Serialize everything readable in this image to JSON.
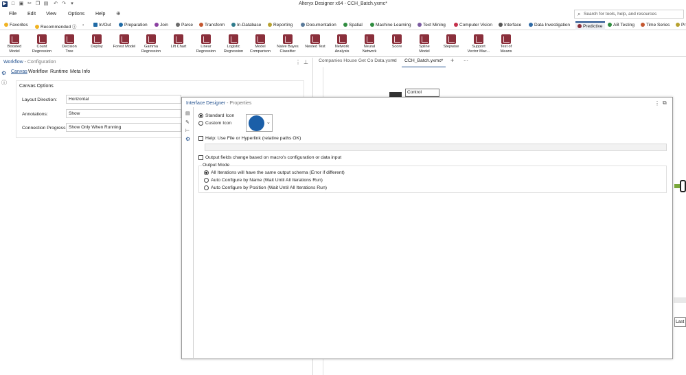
{
  "window": {
    "title": "Alteryx Designer x64 - CCH_Batch.yxmc*"
  },
  "menu": [
    "File",
    "Edit",
    "View",
    "Options",
    "Help"
  ],
  "search": {
    "placeholder": "Search for tools, help, and resources"
  },
  "categories": [
    {
      "label": "Favorites",
      "color": "#444444"
    },
    {
      "label": "Recommended",
      "color": "#444444"
    },
    {
      "label": "In/Out",
      "color": "#1f6aa5"
    },
    {
      "label": "Preparation",
      "color": "#1f6aa5"
    },
    {
      "label": "Join",
      "color": "#8a3fa0"
    },
    {
      "label": "Parse",
      "color": "#6a6a6a"
    },
    {
      "label": "Transform",
      "color": "#c4572f"
    },
    {
      "label": "In-Database",
      "color": "#2f7b8c"
    },
    {
      "label": "Reporting",
      "color": "#b7a12f"
    },
    {
      "label": "Documentation",
      "color": "#5a7a9a"
    },
    {
      "label": "Spatial",
      "color": "#2f8c3f"
    },
    {
      "label": "Machine Learning",
      "color": "#2f8c3f"
    },
    {
      "label": "Text Mining",
      "color": "#7a5aa0"
    },
    {
      "label": "Computer Vision",
      "color": "#c42f4a"
    },
    {
      "label": "Interface",
      "color": "#555555"
    },
    {
      "label": "Data Investigation",
      "color": "#2f6aa5"
    },
    {
      "label": "Predictive",
      "color": "#8a2f3b"
    },
    {
      "label": "AB Testing",
      "color": "#2f8c3f"
    },
    {
      "label": "Time Series",
      "color": "#c4572f"
    },
    {
      "label": "Pr",
      "color": "#b7a12f"
    }
  ],
  "tools": [
    {
      "l1": "Boosted",
      "l2": "Model"
    },
    {
      "l1": "Count",
      "l2": "Regression"
    },
    {
      "l1": "Decision",
      "l2": "Tree"
    },
    {
      "l1": "Deploy",
      "l2": ""
    },
    {
      "l1": "Forest Model",
      "l2": ""
    },
    {
      "l1": "Gamma",
      "l2": "Regression"
    },
    {
      "l1": "Lift Chart",
      "l2": ""
    },
    {
      "l1": "Linear",
      "l2": "Regression"
    },
    {
      "l1": "Logistic",
      "l2": "Regression"
    },
    {
      "l1": "Model",
      "l2": "Comparison"
    },
    {
      "l1": "Naive Bayes",
      "l2": "Classifier"
    },
    {
      "l1": "Nested Test",
      "l2": ""
    },
    {
      "l1": "Network",
      "l2": "Analysis"
    },
    {
      "l1": "Neural",
      "l2": "Network"
    },
    {
      "l1": "Score",
      "l2": ""
    },
    {
      "l1": "Spline",
      "l2": "Model"
    },
    {
      "l1": "Stepwise",
      "l2": ""
    },
    {
      "l1": "Support",
      "l2": "Vector Mac..."
    },
    {
      "l1": "Test of",
      "l2": "Means"
    }
  ],
  "config": {
    "title": "Workflow",
    "subtitle": " - Configuration",
    "tabs": [
      "Canvas",
      "Workflow",
      "Runtime",
      "Meta Info"
    ],
    "section": "Canvas Options",
    "layout_label": "Layout Direction:",
    "layout_value": "Horizontal",
    "annotations_label": "Annotations:",
    "annotations_value": "Show",
    "connection_label": "Connection Progress:",
    "connection_value": "Show Only When Running"
  },
  "doc_tabs": {
    "tab1": "Companies House Get Co Data.yxmd",
    "tab2": "CCH_Batch.yxmc*",
    "control_label": "Control",
    "edge_text": "Last I"
  },
  "designer": {
    "title": "Interface Designer",
    "subtitle": " - Properties",
    "standard_icon": "Standard Icon",
    "custom_icon": "Custom Icon",
    "icon_color": "#1b5fa8",
    "help_label": "Help: Use File or Hyperlink (relative paths OK)",
    "output_fields_label": "Output fields change based on macro's configuration or data input",
    "output_mode_title": "Output Mode",
    "modes": [
      "All Iterations will have the same output schema (Error if different)",
      "Auto Configure by Name (Wait Until All Iterations Run)",
      "Auto Configure by Position (Wait Until All Iterations Run)"
    ]
  }
}
